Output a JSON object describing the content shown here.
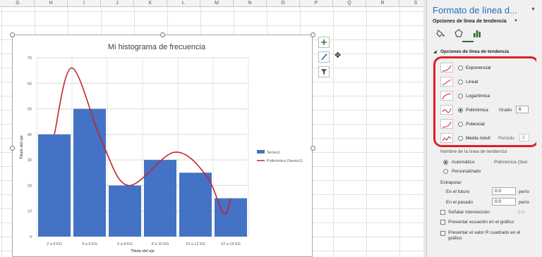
{
  "spreadsheet": {
    "columns": [
      "G",
      "H",
      "I",
      "J",
      "K",
      "L",
      "M",
      "N",
      "O",
      "P",
      "Q",
      "R",
      "S"
    ]
  },
  "chart_tools": {
    "add_element_icon": "plus-icon",
    "style_icon": "brush-icon",
    "filter_icon": "filter-icon"
  },
  "chart_data": {
    "type": "bar",
    "title": "Mi histograma de frecuencia",
    "categories": [
      "2 a 4 KG",
      "4 a 6 KG",
      "6 a 8 KG",
      "8 a 10 KG",
      "10 a 12 KG",
      "12 a 14 KG"
    ],
    "series": [
      {
        "name": "Series1",
        "values": [
          40,
          50,
          20,
          30,
          25,
          15
        ],
        "color": "#4472c4"
      }
    ],
    "trendline": {
      "name": "Polinómica (Series1)",
      "type": "polynomial",
      "order": 6,
      "color": "#c0262d"
    },
    "xlabel": "Título del eje",
    "ylabel": "Título del eje",
    "ylim": [
      0,
      70
    ],
    "yticks": [
      0,
      10,
      20,
      30,
      40,
      50,
      60,
      70
    ],
    "grid": true,
    "legend_position": "right"
  },
  "pane": {
    "title": "Formato de línea d...",
    "subtitle": "Opciones de línea de tendencia",
    "section": "Opciones de línea de tendencia",
    "trend_options": [
      {
        "label": "Exponencial",
        "selected": false
      },
      {
        "label": "Lineal",
        "selected": false
      },
      {
        "label": "Logarítmica",
        "selected": false
      },
      {
        "label": "Polinómica",
        "selected": true
      },
      {
        "label": "Potencial",
        "selected": false
      },
      {
        "label": "Media móvil",
        "selected": false
      }
    ],
    "grado_label": "Grado",
    "grado_value": "6",
    "periodo_label": "Período",
    "periodo_value": "2",
    "name_section": "Nombre de la línea de tendencia",
    "auto_label": "Automático",
    "auto_value": "Polinómica (Seri",
    "custom_label": "Personalizado",
    "extrapolar_label": "Extrapolar",
    "futuro_label": "En el futuro",
    "futuro_value": "0.0",
    "futuro_unit": "perío",
    "pasado_label": "En el pasado",
    "pasado_value": "0.0",
    "pasado_unit": "perío",
    "intersect_label": "Señalar intersección",
    "intersect_value": "0.0",
    "ecuacion_label": "Presentar ecuación en el gráfico",
    "r2_label": "Presentar el valor R cuadrado en el gráfico"
  },
  "colors": {
    "accent": "#1e6fb5",
    "highlight_box": "#e01e2a",
    "bar": "#4472c4",
    "trendline": "#c0262d"
  }
}
